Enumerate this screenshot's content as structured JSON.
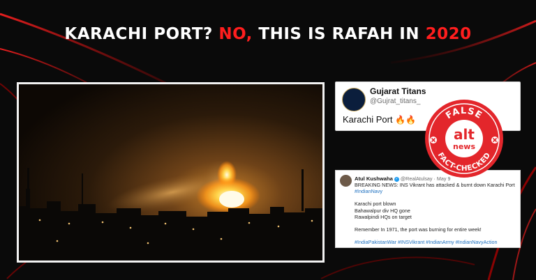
{
  "headline": {
    "part1": "KARACHI PORT? ",
    "part2": "NO,",
    "part3": " THIS IS RAFAH IN ",
    "part4": "2020"
  },
  "colors": {
    "accent_red": "#ff1e1e",
    "stamp_red": "#e3262b",
    "link_blue": "#1d70c0"
  },
  "tweet1": {
    "name": "Gujarat Titans",
    "handle": "@Gujrat_titans_",
    "text": "Karachi Port",
    "emoji": "🔥🔥"
  },
  "stamp": {
    "top_text": "FALSE",
    "logo_top": "alt",
    "logo_bottom": "news",
    "bottom_text": "FACT-CHECKED"
  },
  "tweet2": {
    "name": "Atul Kushwaha",
    "meta": "@RealAtulsay · May 9",
    "line1": "BREAKING NEWS: INS Vikrant has attacked & burnt down Karachi Port",
    "line2": "#IndianNavy",
    "line3": "Karachi port blown",
    "line4": "Bahawalpur div HQ gone",
    "line5": "Rawalpindi HQs on target",
    "line6": "Remember In 1971, the port was burning for entire week!",
    "hashtags": "#IndiaPakistanWar #INSVikrant #IndianArmy #IndianNavyAction"
  }
}
